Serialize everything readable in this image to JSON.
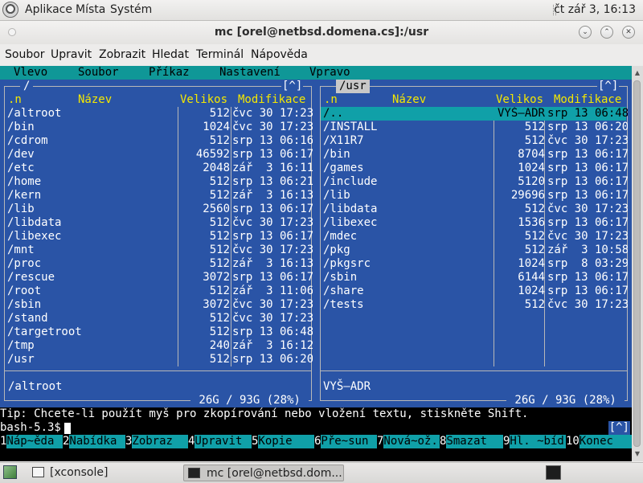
{
  "top_panel": {
    "menus": [
      "Aplikace",
      "Místa",
      "Systém"
    ],
    "clock": "čt zář  3, 16:13",
    "logo_icon": "distro-logo-icon"
  },
  "window": {
    "title": "mc [orel@netbsd.domena.cs]:/usr",
    "menus": [
      "Soubor",
      "Upravit",
      "Zobrazit",
      "Hledat",
      "Terminál",
      "Nápověda"
    ]
  },
  "mc": {
    "menubar": [
      "Vlevo",
      "Soubor",
      "Příkaz",
      "Nastavení",
      "Vpravo"
    ],
    "headers": {
      "name_prefix": ".n",
      "name": "Název",
      "size": "Velikos",
      "mtime": "Modifikace"
    },
    "left_panel": {
      "title": " / ",
      "corner": "[^]",
      "entries": [
        {
          "name": "/altroot",
          "size": "512",
          "mtime": "čvc 30 17:23"
        },
        {
          "name": "/bin",
          "size": "1024",
          "mtime": "čvc 30 17:23"
        },
        {
          "name": "/cdrom",
          "size": "512",
          "mtime": "srp 13 06:16"
        },
        {
          "name": "/dev",
          "size": "46592",
          "mtime": "srp 13 06:17"
        },
        {
          "name": "/etc",
          "size": "2048",
          "mtime": "zář  3 16:11"
        },
        {
          "name": "/home",
          "size": "512",
          "mtime": "srp 13 06:21"
        },
        {
          "name": "/kern",
          "size": "512",
          "mtime": "zář  3 16:13"
        },
        {
          "name": "/lib",
          "size": "2560",
          "mtime": "srp 13 06:17"
        },
        {
          "name": "/libdata",
          "size": "512",
          "mtime": "čvc 30 17:23"
        },
        {
          "name": "/libexec",
          "size": "512",
          "mtime": "srp 13 06:17"
        },
        {
          "name": "/mnt",
          "size": "512",
          "mtime": "čvc 30 17:23"
        },
        {
          "name": "/proc",
          "size": "512",
          "mtime": "zář  3 16:13"
        },
        {
          "name": "/rescue",
          "size": "3072",
          "mtime": "srp 13 06:17"
        },
        {
          "name": "/root",
          "size": "512",
          "mtime": "zář  3 11:06"
        },
        {
          "name": "/sbin",
          "size": "3072",
          "mtime": "čvc 30 17:23"
        },
        {
          "name": "/stand",
          "size": "512",
          "mtime": "čvc 30 17:23"
        },
        {
          "name": "/targetroot",
          "size": "512",
          "mtime": "srp 13 06:48"
        },
        {
          "name": "/tmp",
          "size": "240",
          "mtime": "zář  3 16:12"
        },
        {
          "name": "/usr",
          "size": "512",
          "mtime": "srp 13 06:20"
        }
      ],
      "status": "/altroot",
      "free": " 26G / 93G (28%) "
    },
    "right_panel": {
      "title": " /usr ",
      "corner": "[^]",
      "entries": [
        {
          "name": "/..",
          "size": "VYŠ—ADR",
          "mtime": "srp 13 06:48"
        },
        {
          "name": "/INSTALL",
          "size": "512",
          "mtime": "srp 13 06:20"
        },
        {
          "name": "/X11R7",
          "size": "512",
          "mtime": "čvc 30 17:23"
        },
        {
          "name": "/bin",
          "size": "8704",
          "mtime": "srp 13 06:17"
        },
        {
          "name": "/games",
          "size": "1024",
          "mtime": "srp 13 06:17"
        },
        {
          "name": "/include",
          "size": "5120",
          "mtime": "srp 13 06:17"
        },
        {
          "name": "/lib",
          "size": "29696",
          "mtime": "srp 13 06:17"
        },
        {
          "name": "/libdata",
          "size": "512",
          "mtime": "čvc 30 17:23"
        },
        {
          "name": "/libexec",
          "size": "1536",
          "mtime": "srp 13 06:17"
        },
        {
          "name": "/mdec",
          "size": "512",
          "mtime": "čvc 30 17:23"
        },
        {
          "name": "/pkg",
          "size": "512",
          "mtime": "zář  3 10:58"
        },
        {
          "name": "/pkgsrc",
          "size": "1024",
          "mtime": "srp  8 03:29"
        },
        {
          "name": "/sbin",
          "size": "6144",
          "mtime": "srp 13 06:17"
        },
        {
          "name": "/share",
          "size": "1024",
          "mtime": "srp 13 06:17"
        },
        {
          "name": "/tests",
          "size": "512",
          "mtime": "čvc 30 17:23"
        }
      ],
      "selected_index": 0,
      "status": "VYŠ—ADR",
      "free": " 26G / 93G (28%) "
    },
    "tip": "Tip: Chcete-li použít myš pro zkopírování nebo vložení textu, stiskněte Shift.",
    "prompt": "bash-5.3$ ",
    "subshell_indicator": "[^]",
    "function_keys": [
      {
        "num": "1",
        "label": "Náp~ěda"
      },
      {
        "num": "2",
        "label": "Nabídka"
      },
      {
        "num": "3",
        "label": "Zobraz"
      },
      {
        "num": "4",
        "label": "Upravit"
      },
      {
        "num": "5",
        "label": "Kopie"
      },
      {
        "num": "6",
        "label": "Pře~sun"
      },
      {
        "num": "7",
        "label": "Nová~ož."
      },
      {
        "num": "8",
        "label": "Smazat"
      },
      {
        "num": "9",
        "label": "Hl. ~bíd"
      },
      {
        "num": "10",
        "label": "Konec"
      }
    ]
  },
  "taskbar": {
    "tasks": [
      {
        "label": "[xconsole]",
        "active": false
      },
      {
        "label": "mc [orel@netbsd.dom...",
        "active": true
      }
    ]
  }
}
